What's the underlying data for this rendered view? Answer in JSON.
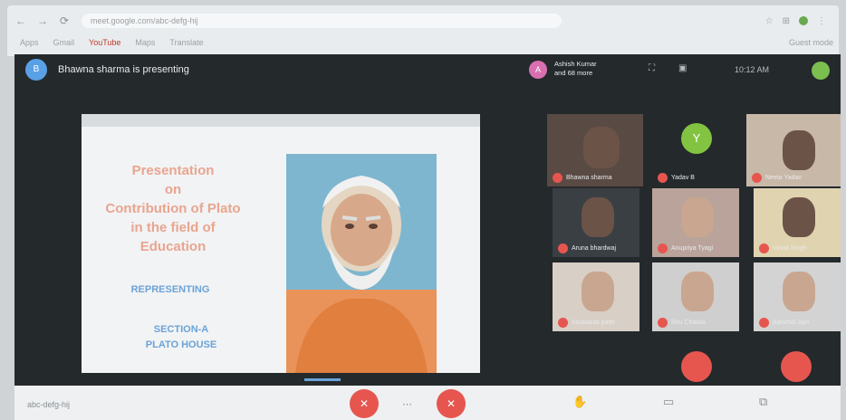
{
  "browser": {
    "url": "meet.google.com/abc-defg-hij",
    "bookmarks": [
      "Apps",
      "Gmail",
      "YouTube",
      "Maps",
      "Translate"
    ],
    "ext_label": "Guest mode"
  },
  "meet": {
    "presenter_initial": "B",
    "presenting_text": "Bhawna sharma is presenting",
    "pinned_initial": "A",
    "pinned_text_line1": "Ashish Kumar",
    "pinned_text_line2": "and 68 more",
    "time": "10:12 AM"
  },
  "slide": {
    "title": "Presentation\non\nContribution of Plato\nin the field of\nEducation",
    "representing": "REPRESENTING",
    "section": "SECTION-A",
    "house": "PLATO HOUSE"
  },
  "participants": [
    {
      "name": "Bhawna sharma"
    },
    {
      "name": "Yadav B",
      "initial": "Y"
    },
    {
      "name": "Neeta Yadav"
    },
    {
      "name": "Aruna bhardwaj"
    },
    {
      "name": "Anupriya Tyagi"
    },
    {
      "name": "Vinod Singh"
    },
    {
      "name": "Saraswati patel"
    },
    {
      "name": "Ritu Chawla"
    },
    {
      "name": "Aanchal Jain"
    }
  ],
  "bottom": {
    "meeting_code": "abc-defg-hij",
    "end_label": "✕",
    "mic_label": "✕",
    "cam_label": "✕"
  },
  "colors": {
    "accent_red": "#e6564f",
    "slide_title": "#e9a58f",
    "slide_blue": "#6aa3d8",
    "meet_bg": "#24292c"
  }
}
